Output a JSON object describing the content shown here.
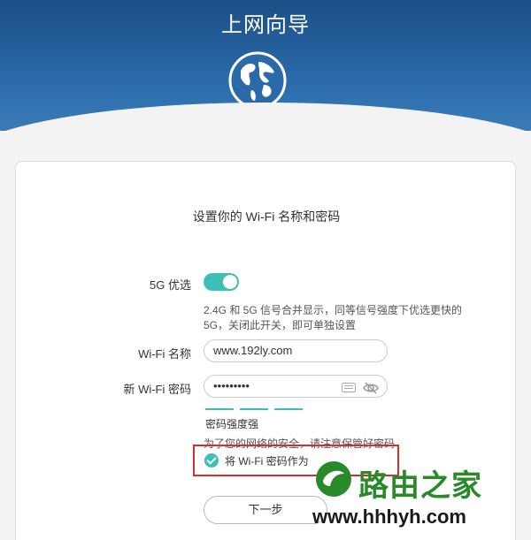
{
  "header": {
    "title": "上网向导",
    "globe_icon": "globe-icon"
  },
  "card": {
    "title": "设置你的 Wi-Fi 名称和密码",
    "band_steering": {
      "label": "5G 优选",
      "enabled": true,
      "description": "2.4G 和 5G 信号合并显示，同等信号强度下优选更快的5G，关闭此开关，即可单独设置"
    },
    "wifi_name": {
      "label": "Wi-Fi 名称",
      "value": "www.192ly.com"
    },
    "wifi_password": {
      "label": "新 Wi-Fi 密码",
      "value": "•••••••••",
      "keyboard_icon": "keyboard-icon",
      "eye_icon": "eye-icon"
    },
    "strength": {
      "label": "密码强度强",
      "level": 3
    },
    "security_note": "为了您的网络的安全，请注意保管好密码",
    "checkbox": {
      "label": "将 Wi-Fi 密码作为",
      "checked": true
    },
    "next_button": "下一步"
  },
  "watermark": {
    "title": "路由之家",
    "url": "www.hhhyh.com"
  },
  "colors": {
    "accent": "#3ebfb6",
    "header": "#1c4f87",
    "highlight": "#d92c2c"
  }
}
